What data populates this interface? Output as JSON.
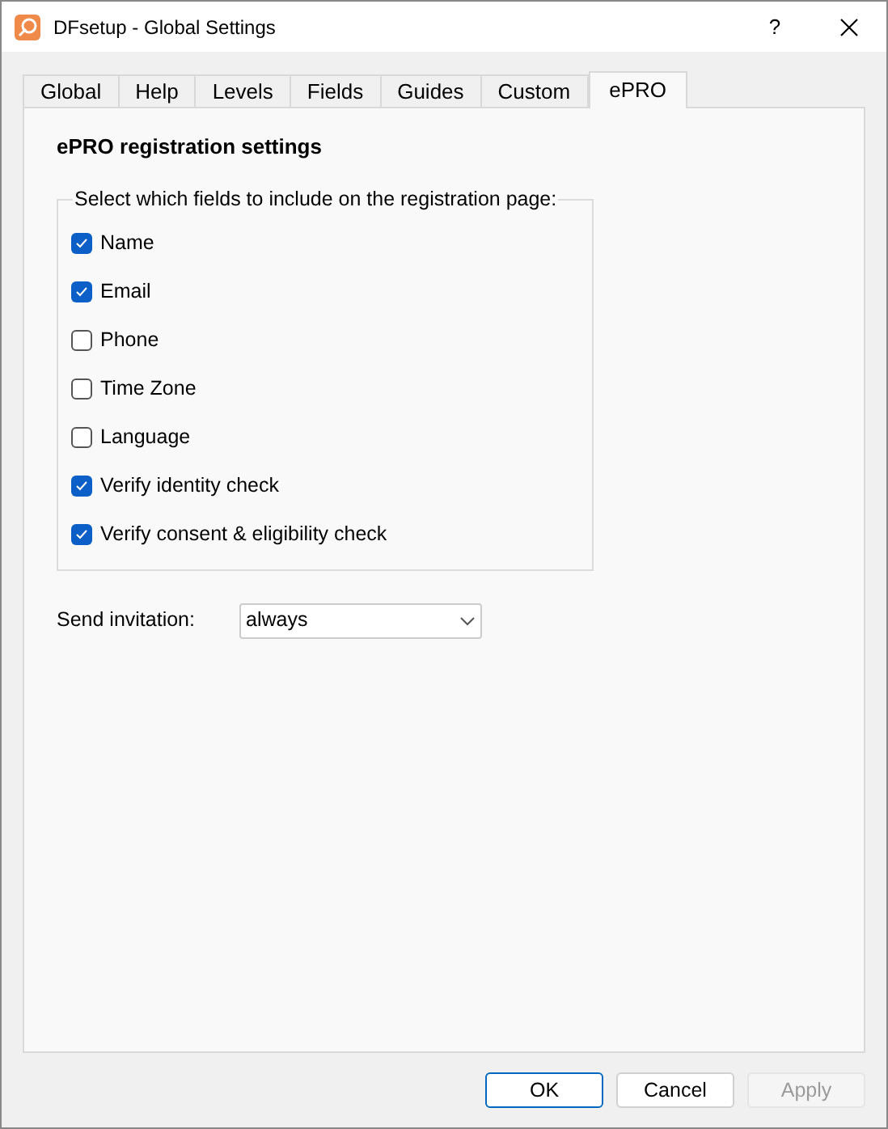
{
  "window": {
    "title": "DFsetup - Global Settings",
    "help": "?"
  },
  "tabs": [
    {
      "label": "Global",
      "selected": false
    },
    {
      "label": "Help",
      "selected": false
    },
    {
      "label": "Levels",
      "selected": false
    },
    {
      "label": "Fields",
      "selected": false
    },
    {
      "label": "Guides",
      "selected": false
    },
    {
      "label": "Custom",
      "selected": false
    },
    {
      "label": "ePRO",
      "selected": true
    }
  ],
  "heading": "ePRO registration settings",
  "fields_group": {
    "legend": "Select which fields to include on the registration page:",
    "items": [
      {
        "label": "Name",
        "checked": true
      },
      {
        "label": "Email",
        "checked": true
      },
      {
        "label": "Phone",
        "checked": false
      },
      {
        "label": "Time Zone",
        "checked": false
      },
      {
        "label": "Language",
        "checked": false
      },
      {
        "label": "Verify identity check",
        "checked": true
      },
      {
        "label": "Verify consent & eligibility check",
        "checked": true
      }
    ]
  },
  "send_invitation": {
    "label": "Send invitation:",
    "value": "always"
  },
  "buttons": [
    {
      "label": "OK",
      "default": true,
      "disabled": false
    },
    {
      "label": "Cancel",
      "default": false,
      "disabled": false
    },
    {
      "label": "Apply",
      "default": false,
      "disabled": true
    }
  ]
}
